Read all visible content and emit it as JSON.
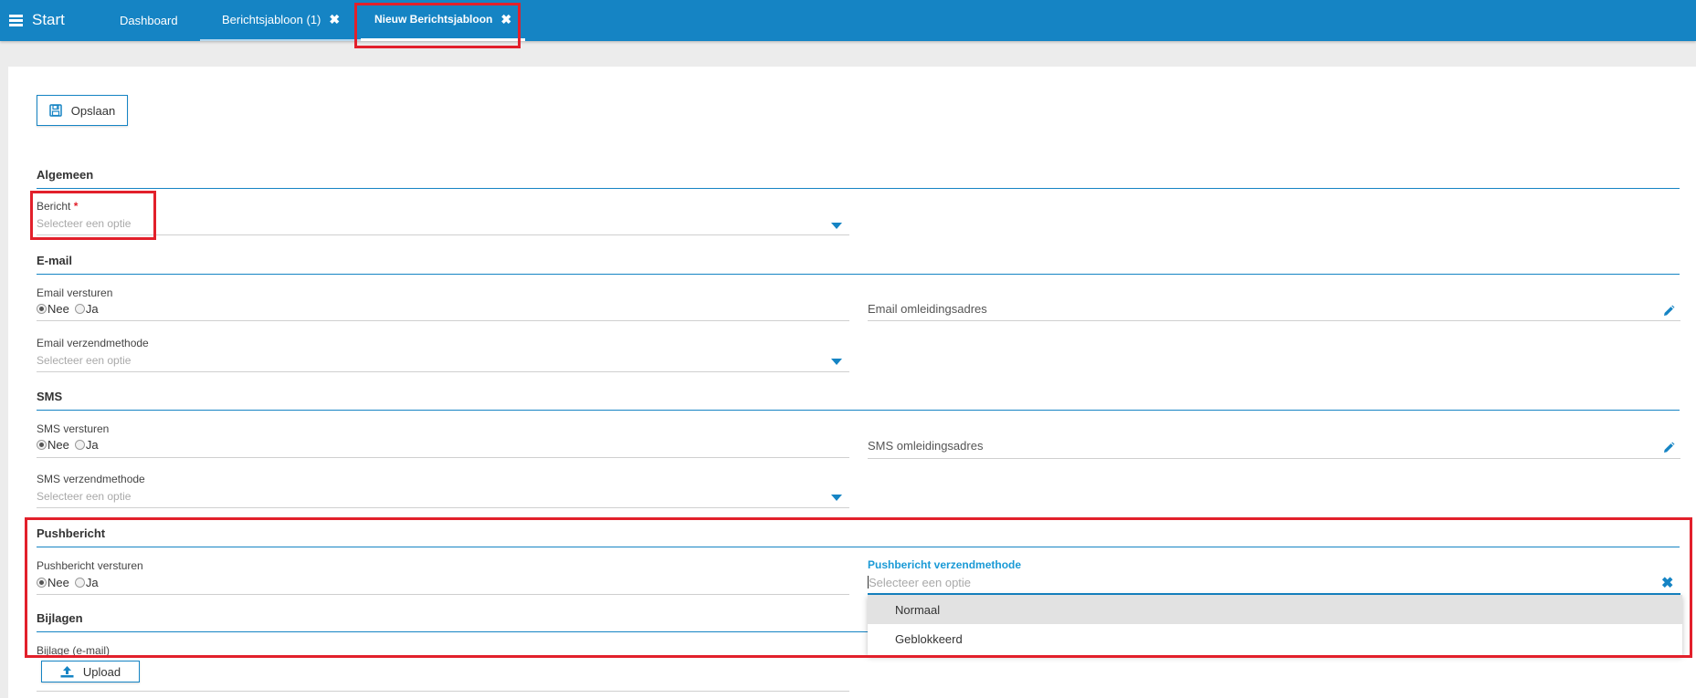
{
  "topbar": {
    "start_label": "Start",
    "tabs": [
      {
        "label": "Dashboard",
        "closable": false
      },
      {
        "label": "Berichtsjabloon (1)",
        "closable": true
      },
      {
        "label": "Nieuw Berichtsjabloon",
        "closable": true,
        "active": true
      }
    ],
    "close_glyph": "✖"
  },
  "toolbar": {
    "save_label": "Opslaan",
    "save_icon": "floppy-disk-icon"
  },
  "sections": {
    "algemeen": {
      "title": "Algemeen",
      "bericht": {
        "label": "Bericht",
        "required_mark": "*",
        "placeholder": "Selecteer een optie"
      }
    },
    "email": {
      "title": "E-mail",
      "send": {
        "label": "Email versturen",
        "options": [
          "Nee",
          "Ja"
        ],
        "selected": "Nee"
      },
      "redirect": {
        "label": "Email omleidingsadres"
      },
      "method": {
        "label": "Email verzendmethode",
        "placeholder": "Selecteer een optie"
      }
    },
    "sms": {
      "title": "SMS",
      "send": {
        "label": "SMS versturen",
        "options": [
          "Nee",
          "Ja"
        ],
        "selected": "Nee"
      },
      "redirect": {
        "label": "SMS omleidingsadres"
      },
      "method": {
        "label": "SMS verzendmethode",
        "placeholder": "Selecteer een optie"
      }
    },
    "push": {
      "title": "Pushbericht",
      "send": {
        "label": "Pushbericht versturen",
        "options": [
          "Nee",
          "Ja"
        ],
        "selected": "Nee"
      },
      "method": {
        "label": "Pushbericht verzendmethode",
        "placeholder": "Selecteer een optie",
        "clear_glyph": "✖",
        "options": [
          "Normaal",
          "Geblokkeerd"
        ],
        "highlighted": "Normaal"
      }
    },
    "bijlagen": {
      "title": "Bijlagen",
      "attachment": {
        "label": "Bijlage (e-mail)",
        "upload_label": "Upload"
      }
    }
  },
  "colors": {
    "primary": "#1584c4",
    "highlight_box": "#e2202b",
    "required": "#e2202b"
  }
}
